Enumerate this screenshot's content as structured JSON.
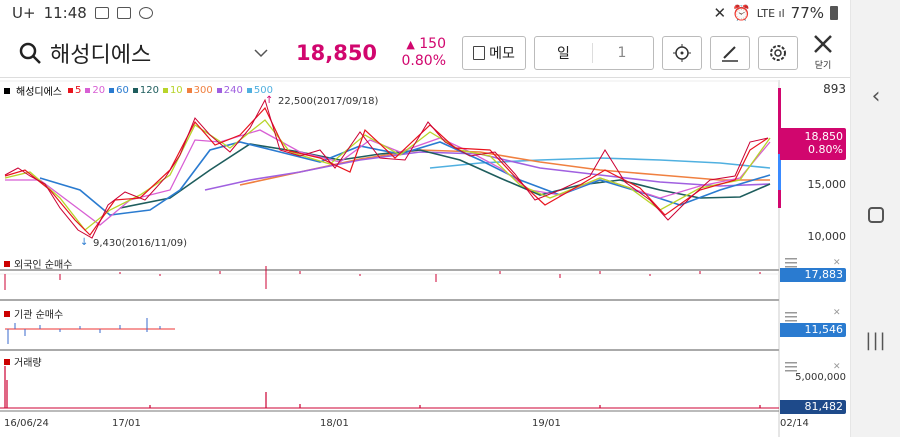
{
  "status": {
    "carrier": "U+",
    "time": "11:48",
    "battery": "77%"
  },
  "toolbar": {
    "stock_name": "해성디에스",
    "price": "18,850",
    "change_value": "150",
    "change_pct": "0.80%",
    "memo_label": "메모",
    "period_label": "일",
    "period_count": "1",
    "close_label": "닫기"
  },
  "chart": {
    "top_right_value": "893",
    "price_tag_value": "18,850",
    "price_tag_pct": "0.80%",
    "yaxis": [
      "15,000",
      "10,000"
    ],
    "high_annotation": "22,500(2017/09/18)",
    "low_annotation": "9,430(2016/11/09)",
    "legend_name": "해성디에스",
    "legend_items": [
      {
        "label": "5",
        "color": "#e8141e"
      },
      {
        "label": "20",
        "color": "#d85fd4"
      },
      {
        "label": "60",
        "color": "#2a7bd0"
      },
      {
        "label": "120",
        "color": "#1e5d5d"
      },
      {
        "label": "10",
        "color": "#b8d42a"
      },
      {
        "label": "300",
        "color": "#f08040"
      },
      {
        "label": "240",
        "color": "#a060e0"
      },
      {
        "label": "500",
        "color": "#50b0e0"
      }
    ],
    "panels": {
      "foreign": {
        "label": "외국인 순매수",
        "value": "17,883"
      },
      "institution": {
        "label": "기관 순매수",
        "value": "11,546"
      },
      "volume": {
        "label": "거래량",
        "value": "81,482",
        "axis": "5,000,000"
      }
    },
    "x_labels": [
      "16/06/24",
      "17/01",
      "18/01",
      "19/01",
      "02/14"
    ]
  }
}
